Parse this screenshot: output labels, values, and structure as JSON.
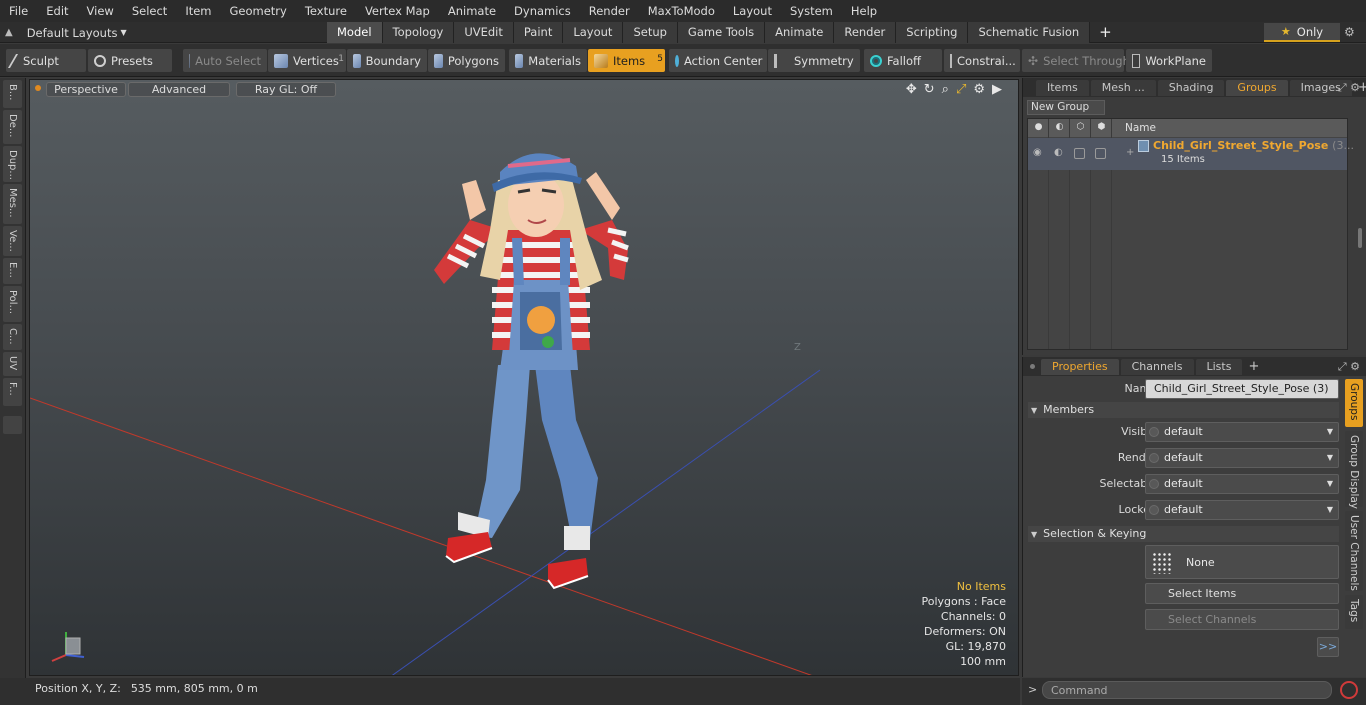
{
  "menu": [
    "File",
    "Edit",
    "View",
    "Select",
    "Item",
    "Geometry",
    "Texture",
    "Vertex Map",
    "Animate",
    "Dynamics",
    "Render",
    "MaxToModo",
    "Layout",
    "System",
    "Help"
  ],
  "layout_selector": "Default Layouts",
  "tabs": [
    {
      "label": "Model",
      "active": true
    },
    {
      "label": "Topology",
      "active": false
    },
    {
      "label": "UVEdit",
      "active": false
    },
    {
      "label": "Paint",
      "active": false
    },
    {
      "label": "Layout",
      "active": false
    },
    {
      "label": "Setup",
      "active": false
    },
    {
      "label": "Game Tools",
      "active": false
    },
    {
      "label": "Animate",
      "active": false
    },
    {
      "label": "Render",
      "active": false
    },
    {
      "label": "Scripting",
      "active": false
    },
    {
      "label": "Schematic Fusion",
      "active": false
    }
  ],
  "only_label": "Only",
  "toolbar": {
    "sculpt": "Sculpt",
    "presets": "Presets",
    "auto_select": "Auto Select",
    "vertices": "Vertices",
    "vertices_count": "1",
    "boundary": "Boundary",
    "polygons": "Polygons",
    "materials": "Materials",
    "items": "Items",
    "items_count": "5",
    "action_center": "Action Center",
    "symmetry": "Symmetry",
    "falloff": "Falloff",
    "constraints": "Constrai...",
    "select_through": "Select Through",
    "workplane": "WorkPlane"
  },
  "left_tabs": [
    "B...",
    "De...",
    "Dup...",
    "Mes...",
    "Ve...",
    "E...",
    "Pol...",
    "C...",
    "UV",
    "F..."
  ],
  "viewport": {
    "perspective": "Perspective",
    "advanced": "Advanced",
    "raygl": "Ray GL: Off",
    "axis_z": "Z",
    "hud": {
      "items": "No Items",
      "polygons": "Polygons : Face",
      "channels": "Channels: 0",
      "deformers": "Deformers: ON",
      "gl": "GL: 19,870",
      "scale": "100 mm"
    }
  },
  "status": {
    "label": "Position X, Y, Z:",
    "value": "535 mm, 805 mm, 0 m"
  },
  "right_top": {
    "tabs": [
      {
        "label": "Items",
        "active": false
      },
      {
        "label": "Mesh ...",
        "active": false
      },
      {
        "label": "Shading",
        "active": false
      },
      {
        "label": "Groups",
        "active": true
      },
      {
        "label": "Images",
        "active": false
      }
    ],
    "new_group": "New Group",
    "name_header": "Name",
    "group": {
      "name": "Child_Girl_Street_Style_Pose",
      "suffix": "(3...",
      "sub": "15 Items"
    }
  },
  "right_bottom": {
    "tabs": [
      {
        "label": "Properties",
        "active": true
      },
      {
        "label": "Channels",
        "active": false
      },
      {
        "label": "Lists",
        "active": false
      }
    ],
    "name_label": "Name",
    "name_value": "Child_Girl_Street_Style_Pose (3)",
    "members": "Members",
    "visible_label": "Visible",
    "visible_value": "default",
    "render_label": "Render",
    "render_value": "default",
    "selectable_label": "Selectable",
    "selectable_value": "default",
    "locked_label": "Locked",
    "locked_value": "default",
    "selection_keying": "Selection & Keying",
    "none": "None",
    "select_items": "Select Items",
    "select_channels": "Select Channels",
    "more": ">>",
    "side_tabs": [
      {
        "label": "Groups",
        "active": true
      },
      {
        "label": "Group Display",
        "active": false
      },
      {
        "label": "User Channels",
        "active": false
      },
      {
        "label": "Tags",
        "active": false
      }
    ]
  },
  "command_placeholder": "Command"
}
